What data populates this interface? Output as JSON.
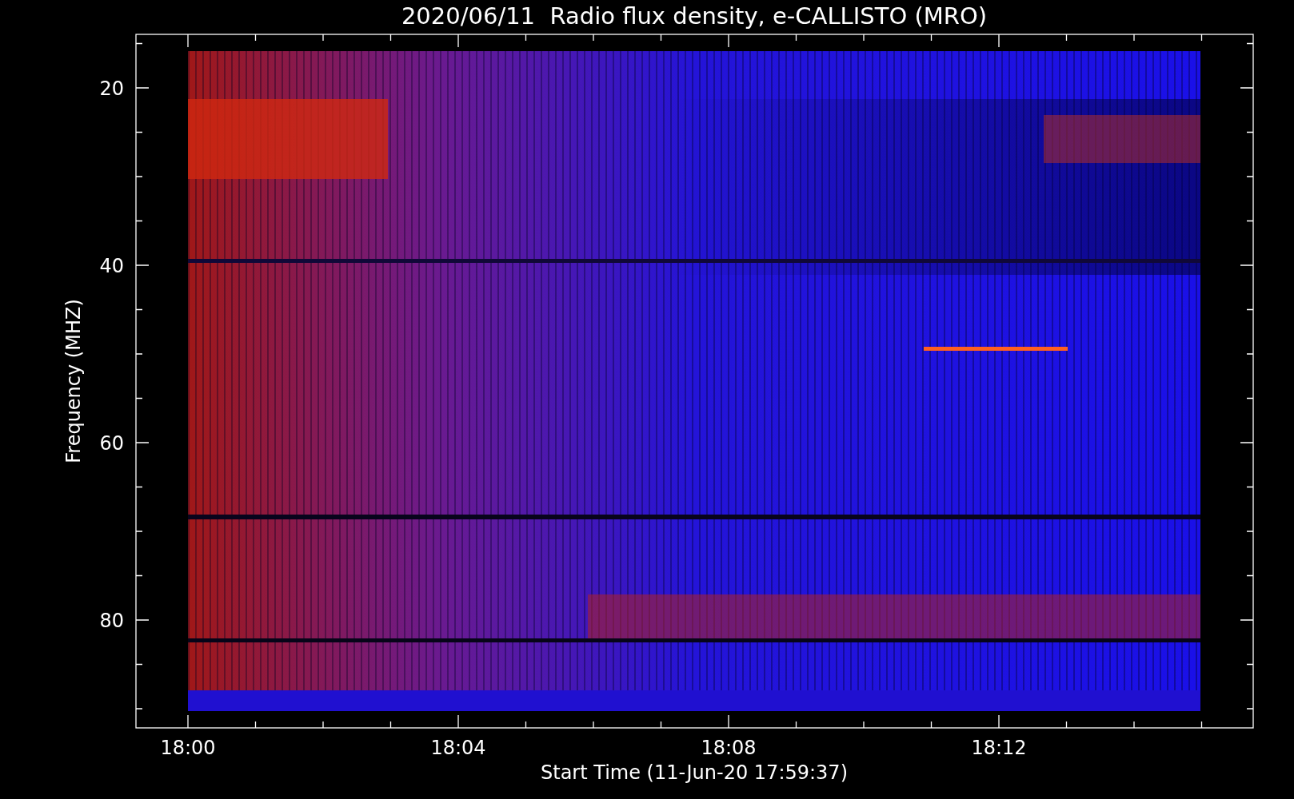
{
  "title": "2020/06/11  Radio flux density, e-CALLISTO (MRO)",
  "plot": {
    "y_axis": {
      "label": "Frequency (MHZ)",
      "ticks": [
        "20",
        "40",
        "60",
        "80"
      ]
    },
    "x_axis": {
      "label": "Start Time (11-Jun-20 17:59:37)",
      "ticks": [
        "18:00",
        "18:04",
        "18:08",
        "18:12"
      ]
    }
  }
}
